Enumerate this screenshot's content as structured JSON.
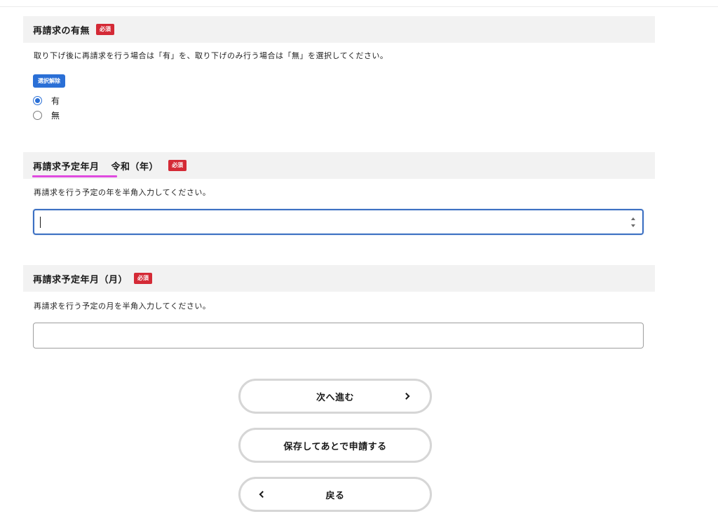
{
  "section_rebill": {
    "title": "再請求の有無",
    "required_badge": "必須",
    "help": "取り下げ後に再請求を行う場合は「有」を、取り下げのみ行う場合は「無」を選択してください。",
    "clear_label": "選択解除",
    "options": [
      {
        "label": "有",
        "checked": true
      },
      {
        "label": "無",
        "checked": false
      }
    ]
  },
  "section_year": {
    "title_main": "再請求予定年月",
    "title_suffix": "令和（年）",
    "required_badge": "必須",
    "help": "再請求を行う予定の年を半角入力してください。",
    "value": ""
  },
  "section_month": {
    "title": "再請求予定年月（月）",
    "required_badge": "必須",
    "help": "再請求を行う予定の月を半角入力してください。",
    "value": ""
  },
  "buttons": {
    "next_label": "次へ進む",
    "save_later_label": "保存してあとで申請する",
    "back_label": "戻る"
  },
  "colors": {
    "required_badge": "#d42a36",
    "accent_blue": "#2a6fd6",
    "highlight": "#e04be0",
    "header_bg": "#f2f2f2"
  }
}
